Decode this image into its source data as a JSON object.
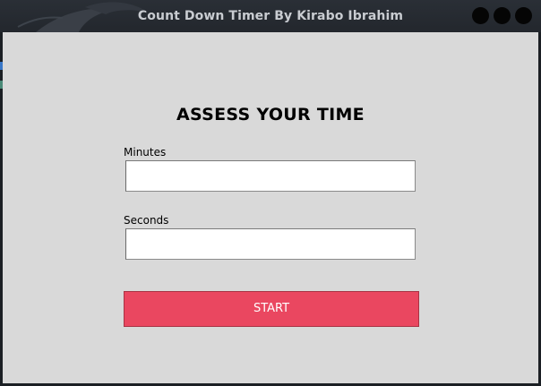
{
  "window": {
    "title": "Count Down Timer By Kirabo Ibrahim",
    "controls": [
      "minimize-icon",
      "maximize-icon",
      "close-icon"
    ]
  },
  "main": {
    "heading": "ASSESS YOUR TIME",
    "minutes": {
      "label": "Minutes",
      "value": ""
    },
    "seconds": {
      "label": "Seconds",
      "value": ""
    },
    "start_label": "START"
  },
  "colors": {
    "titlebar": "#23272d",
    "background": "#d9d9d9",
    "start_button": "#ea4760",
    "title_text": "#c9ccd1"
  }
}
